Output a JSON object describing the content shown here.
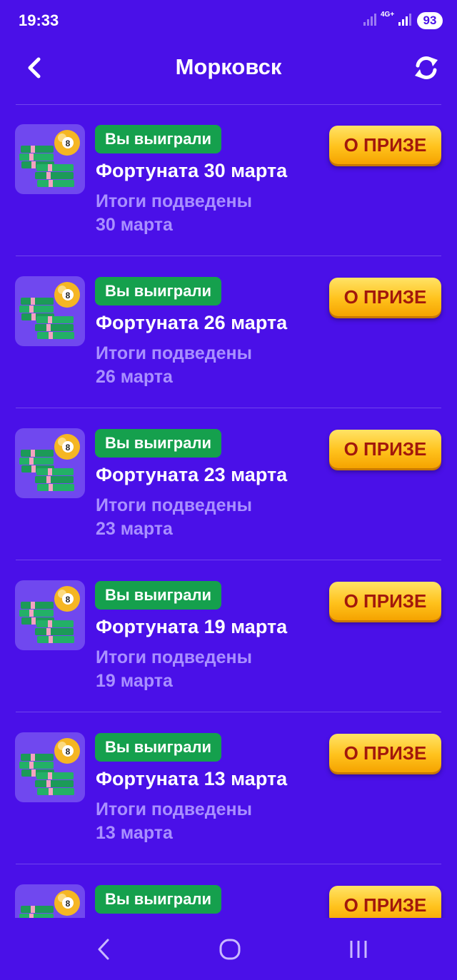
{
  "status_bar": {
    "time": "19:33",
    "network": "4G+",
    "battery": "93"
  },
  "header": {
    "title": "Морковск",
    "back_icon": "chevron-left-icon",
    "refresh_icon": "refresh-icon"
  },
  "items": [
    {
      "badge": "Вы выиграли",
      "name": "Фортуната 30 марта",
      "result_line1": "Итоги подведены",
      "result_line2": "30 марта",
      "button": "О ПРИЗЕ"
    },
    {
      "badge": "Вы выиграли",
      "name": "Фортуната 26 марта",
      "result_line1": "Итоги подведены",
      "result_line2": "26 марта",
      "button": "О ПРИЗЕ"
    },
    {
      "badge": "Вы выиграли",
      "name": "Фортуната 23 марта",
      "result_line1": "Итоги подведены",
      "result_line2": "23 марта",
      "button": "О ПРИЗЕ"
    },
    {
      "badge": "Вы выиграли",
      "name": "Фортуната 19 марта",
      "result_line1": "Итоги подведены",
      "result_line2": "19 марта",
      "button": "О ПРИЗЕ"
    },
    {
      "badge": "Вы выиграли",
      "name": "Фортуната 13 марта",
      "result_line1": "Итоги подведены",
      "result_line2": "13 марта",
      "button": "О ПРИЗЕ"
    },
    {
      "badge": "Вы выиграли",
      "name": "",
      "result_line1": "",
      "result_line2": "",
      "button": "О ПРИЗЕ"
    }
  ],
  "colors": {
    "background": "#4a10e8",
    "badge": "#15a04d",
    "button": "#ffc21c",
    "button_text": "#a2180c",
    "muted_text": "#a990ff"
  },
  "nav": {
    "back_icon": "nav-back-icon",
    "home_icon": "nav-home-icon",
    "recents_icon": "nav-recents-icon"
  }
}
